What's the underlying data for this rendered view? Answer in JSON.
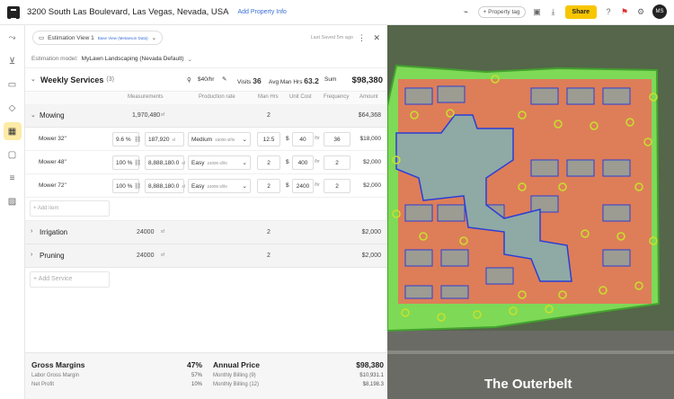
{
  "topbar": {
    "address": "3200 South Las Boulevard, Las Vegas, Nevada, USA",
    "add_property_info": "Add Property Info",
    "property_tag": "+ Property tag",
    "share_label": "Share",
    "avatar_initials": "MS"
  },
  "panel": {
    "view_name": "Estimation View 1",
    "view_sub": "Base View (Metaeson Data)",
    "last_saved": "Last Saved 5m ago",
    "estimation_model_label": "Estimation model:",
    "estimation_model_value": "MyLawn Landscaping (Nevada Default)"
  },
  "weekly": {
    "title": "Weekly Services",
    "count": "(3)",
    "rate": "$40/hr",
    "visits_label": "Visits",
    "visits_value": "36",
    "avg_label": "Avg Man Hrs",
    "avg_value": "63.2",
    "sum_label": "Sum",
    "sum_value": "$98,380"
  },
  "columns": {
    "measurements": "Measurements",
    "production_rate": "Production rate",
    "man_hrs": "Man Hrs",
    "unit_cost": "Unit Cost",
    "frequency": "Frequency",
    "amount": "Amount"
  },
  "mowing": {
    "name": "Mowing",
    "measurement": "1,970,480",
    "unit": "sf",
    "man_hrs": "2",
    "amount": "$64,368",
    "items": [
      {
        "name": "Mower 32\"",
        "pct": "9.6",
        "meas": "187,920",
        "unit": "sf",
        "rate_label": "Medium",
        "rate_value": "15000 sf/hr",
        "man_hrs": "12.5",
        "cost": "40",
        "cost_unit": "/hr",
        "freq": "36",
        "amount": "$18,000"
      },
      {
        "name": "Mower 48\"",
        "pct": "100",
        "meas": "8,888,180.0",
        "unit": "sf",
        "rate_label": "Easy",
        "rate_value": "24000 sf/hr",
        "man_hrs": "2",
        "cost": "400",
        "cost_unit": "/hr",
        "freq": "2",
        "amount": "$2,000"
      },
      {
        "name": "Mower 72\"",
        "pct": "100",
        "meas": "8,888,180.0",
        "unit": "sf",
        "rate_label": "Easy",
        "rate_value": "24000 sf/hr",
        "man_hrs": "2",
        "cost": "2400",
        "cost_unit": "/hr",
        "freq": "2",
        "amount": "$2,000"
      }
    ],
    "add_item": "+ Add item"
  },
  "irrigation": {
    "name": "Irrigation",
    "measurement": "24000",
    "unit": "sf",
    "man_hrs": "2",
    "amount": "$2,000"
  },
  "pruning": {
    "name": "Pruning",
    "measurement": "24000",
    "unit": "sf",
    "man_hrs": "2",
    "amount": "$2,000"
  },
  "add_service": "+ Add Service",
  "footer": {
    "gross_margins_label": "Gross Margins",
    "gross_margins_value": "47%",
    "labor_label": "Labor Gross Margin",
    "labor_value": "57%",
    "net_label": "Net Profit",
    "net_value": "10%",
    "annual_label": "Annual Price",
    "annual_value": "$98,380",
    "monthly9_label": "Monthly Billing (9)",
    "monthly9_value": "$10,931.1",
    "monthly12_label": "Monthly Billing (12)",
    "monthly12_value": "$8,198.3"
  },
  "map": {
    "road_label": "The Outerbelt",
    "colors": {
      "turf": "#7ed957",
      "hardscape": "#e8735a",
      "edge": "#2b3fd6",
      "trees": "#c9e02b",
      "water": "#8fa9a5"
    }
  }
}
